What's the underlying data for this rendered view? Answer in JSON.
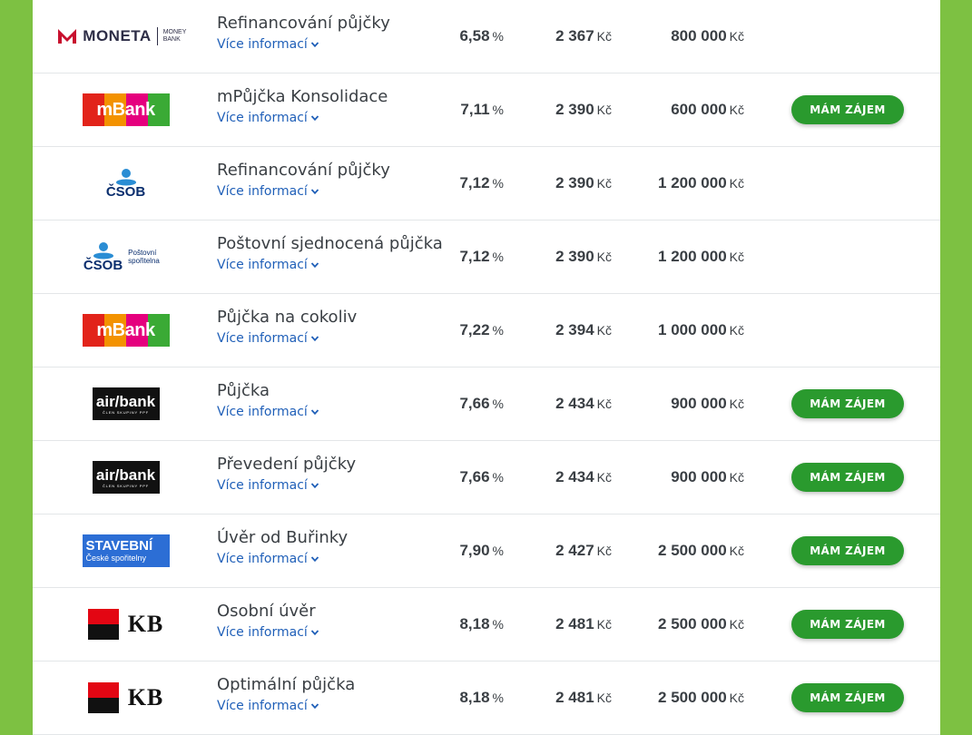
{
  "cta_label": "MÁM ZÁJEM",
  "more_label": "Více informací",
  "rate_unit": "%",
  "currency_unit": "Kč",
  "colors": {
    "background": "#7dc142",
    "cta": "#2a9a2e",
    "link": "#1f5fb8"
  },
  "rows": [
    {
      "bank": "moneta",
      "logo_text": "MONETA",
      "logo_sub": "MONEY BANK",
      "product": "Refinancování půjčky",
      "rate": "6,58",
      "payment": "2 367",
      "amount": "800 000",
      "cta": false
    },
    {
      "bank": "mbank",
      "logo_text": "mBank",
      "product": "mPůjčka Konsolidace",
      "rate": "7,11",
      "payment": "2 390",
      "amount": "600 000",
      "cta": true
    },
    {
      "bank": "csob",
      "logo_text": "ČSOB",
      "product": "Refinancování půjčky",
      "rate": "7,12",
      "payment": "2 390",
      "amount": "1 200 000",
      "cta": false
    },
    {
      "bank": "csob-ps",
      "logo_text": "ČSOB",
      "logo_sub": "Poštovní spořitelna",
      "product": "Poštovní sjednocená půjčka",
      "rate": "7,12",
      "payment": "2 390",
      "amount": "1 200 000",
      "cta": false
    },
    {
      "bank": "mbank",
      "logo_text": "mBank",
      "product": "Půjčka na cokoliv",
      "rate": "7,22",
      "payment": "2 394",
      "amount": "1 000 000",
      "cta": false
    },
    {
      "bank": "airbank",
      "logo_text": "air/bank",
      "logo_sub": "ČLEN SKUPINY PPF",
      "product": "Půjčka",
      "rate": "7,66",
      "payment": "2 434",
      "amount": "900 000",
      "cta": true
    },
    {
      "bank": "airbank",
      "logo_text": "air/bank",
      "logo_sub": "ČLEN SKUPINY PPF",
      "product": "Převedení půjčky",
      "rate": "7,66",
      "payment": "2 434",
      "amount": "900 000",
      "cta": true
    },
    {
      "bank": "stavebni",
      "logo_text": "STAVEBNÍ",
      "logo_sub": "České spořitelny",
      "product": "Úvěr od Buřinky",
      "rate": "7,90",
      "payment": "2 427",
      "amount": "2 500 000",
      "cta": true
    },
    {
      "bank": "kb",
      "logo_text": "KB",
      "product": "Osobní úvěr",
      "rate": "8,18",
      "payment": "2 481",
      "amount": "2 500 000",
      "cta": true
    },
    {
      "bank": "kb",
      "logo_text": "KB",
      "product": "Optimální půjčka",
      "rate": "8,18",
      "payment": "2 481",
      "amount": "2 500 000",
      "cta": true
    }
  ]
}
